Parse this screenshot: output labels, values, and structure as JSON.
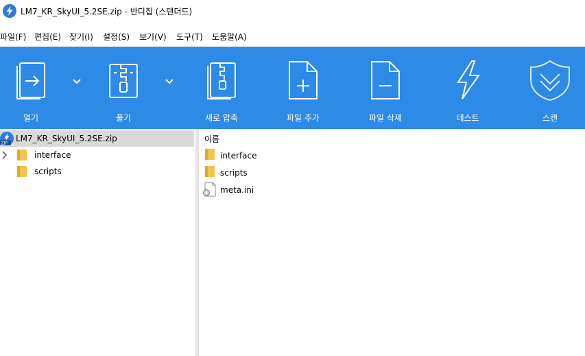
{
  "window": {
    "title": "LM7_KR_SkyUI_5.2SE.zip - 반디집 (스탠더드)"
  },
  "menu": [
    "파일(F)",
    "편집(E)",
    "찾기(I)",
    "설정(S)",
    "보기(V)",
    "도구(T)",
    "도움말(A)"
  ],
  "toolbar": {
    "open": "열기",
    "extract": "풀기",
    "new_archive": "새로 압축",
    "add_files": "파일 추가",
    "delete_files": "파일 삭제",
    "test": "테스트",
    "scan": "스캔"
  },
  "tree": {
    "root": "LM7_KR_SkyUI_5.2SE.zip",
    "children": [
      "interface",
      "scripts"
    ]
  },
  "list": {
    "column_name": "이름",
    "items": [
      {
        "name": "interface",
        "icon": "folder-icon"
      },
      {
        "name": "scripts",
        "icon": "folder-icon"
      },
      {
        "name": "meta.ini",
        "icon": "settings-file-icon"
      }
    ]
  },
  "colors": {
    "toolbar": "#2d8ae6",
    "folder": "#f5c44a",
    "selection": "#d9d9d9"
  }
}
